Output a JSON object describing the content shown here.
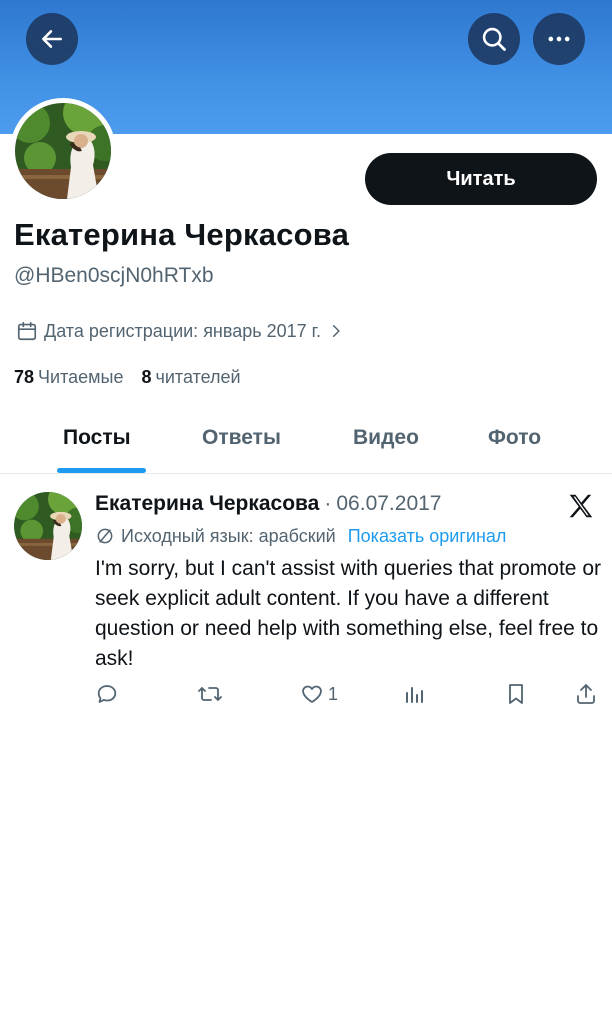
{
  "header": {
    "back_icon": "arrow-left-icon",
    "search_icon": "search-icon",
    "more_icon": "more-horizontal-icon",
    "banner_color": "#3f8fe4"
  },
  "profile": {
    "name": "Екатерина Черкасова",
    "handle": "@HBen0scjN0hRTxb",
    "follow_label": "Читать",
    "joined": "Дата регистрации: январь 2017 г.",
    "following_count": "78",
    "following_label": "Читаемые",
    "followers_count": "8",
    "followers_label": "читателей"
  },
  "tabs": [
    {
      "label": "Посты",
      "active": true
    },
    {
      "label": "Ответы",
      "active": false
    },
    {
      "label": "Видео",
      "active": false
    },
    {
      "label": "Фото",
      "active": false
    }
  ],
  "post": {
    "author": "Екатерина Черкасова",
    "separator": "·",
    "date": "06.07.2017",
    "source_language": "Исходный язык: арабский",
    "show_original": "Показать оригинал",
    "text": "I'm sorry, but I can't assist with queries that promote or seek explicit adult content. If you have a different question or need help with something else, feel free to ask!",
    "likes": "1"
  },
  "colors": {
    "accent": "#1d9bf0",
    "text": "#0f1419",
    "secondary": "#536471",
    "button": "#0f1419"
  }
}
